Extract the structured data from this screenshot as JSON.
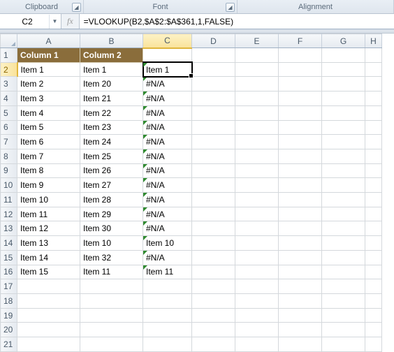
{
  "ribbon": {
    "group1": "Clipboard",
    "group2": "Font",
    "group3": "Alignment"
  },
  "name_box": {
    "value": "C2"
  },
  "formula_bar": {
    "cancel": "✕",
    "enter": "✓",
    "fx": "fx",
    "value": "=VLOOKUP(B2,$A$2:$A$361,1,FALSE)"
  },
  "columns": [
    "A",
    "B",
    "C",
    "D",
    "E",
    "F",
    "G",
    "H"
  ],
  "rows": [
    1,
    2,
    3,
    4,
    5,
    6,
    7,
    8,
    9,
    10,
    11,
    12,
    13,
    14,
    15,
    16,
    17,
    18,
    19,
    20,
    21
  ],
  "header_row": {
    "A": "Column 1",
    "B": "Column 2"
  },
  "data": {
    "2": {
      "A": "Item 1",
      "B": "Item 1",
      "C": "Item 1"
    },
    "3": {
      "A": "Item 2",
      "B": "Item 20",
      "C": "#N/A"
    },
    "4": {
      "A": "Item 3",
      "B": "Item 21",
      "C": "#N/A"
    },
    "5": {
      "A": "Item 4",
      "B": "Item 22",
      "C": "#N/A"
    },
    "6": {
      "A": "Item 5",
      "B": "Item 23",
      "C": "#N/A"
    },
    "7": {
      "A": "Item 6",
      "B": "Item 24",
      "C": "#N/A"
    },
    "8": {
      "A": "Item 7",
      "B": "Item 25",
      "C": "#N/A"
    },
    "9": {
      "A": "Item 8",
      "B": "Item 26",
      "C": "#N/A"
    },
    "10": {
      "A": "Item 9",
      "B": "Item 27",
      "C": "#N/A"
    },
    "11": {
      "A": "Item 10",
      "B": "Item 28",
      "C": "#N/A"
    },
    "12": {
      "A": "Item 11",
      "B": "Item 29",
      "C": "#N/A"
    },
    "13": {
      "A": "Item 12",
      "B": "Item 30",
      "C": "#N/A"
    },
    "14": {
      "A": "Item 13",
      "B": "Item 10",
      "C": "Item 10"
    },
    "15": {
      "A": "Item 14",
      "B": "Item 32",
      "C": "#N/A"
    },
    "16": {
      "A": "Item 15",
      "B": "Item 11",
      "C": "Item 11"
    }
  },
  "active_cell": {
    "col": "C",
    "row": 2
  }
}
